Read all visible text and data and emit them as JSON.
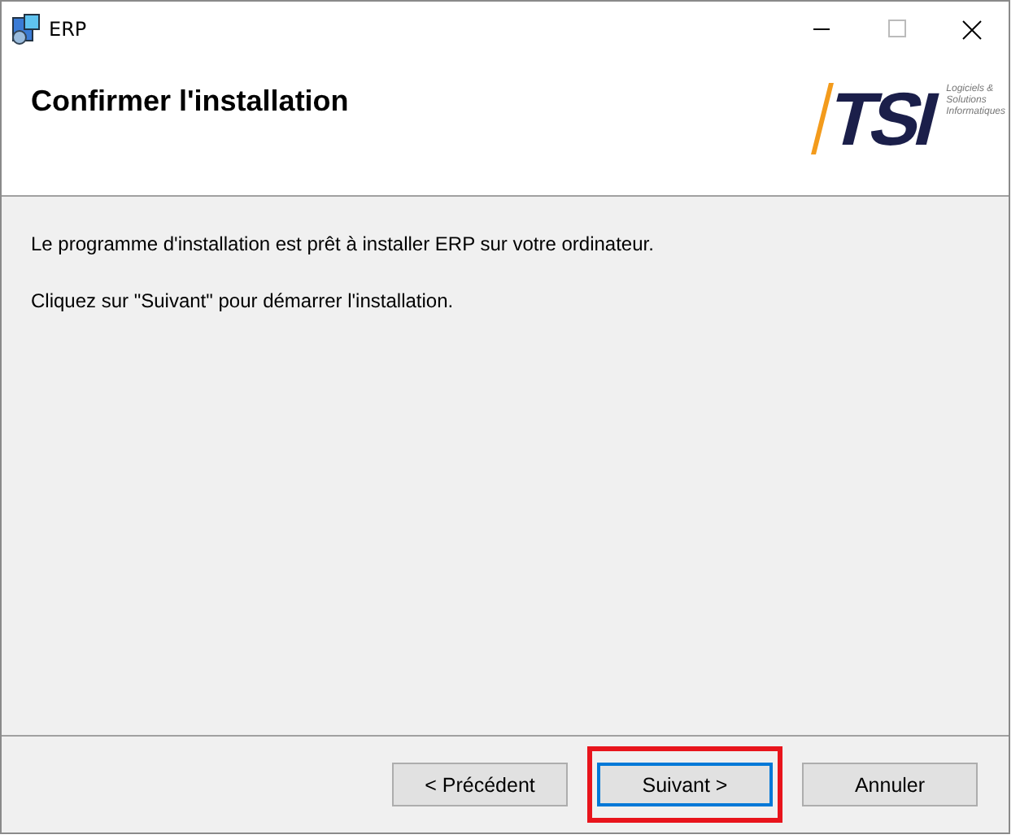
{
  "window": {
    "title": "ERP"
  },
  "header": {
    "title": "Confirmer l'installation",
    "logo": {
      "letters": "TSI",
      "tagline": [
        "Logiciels &",
        "Solutions",
        "Informatiques"
      ]
    }
  },
  "body": {
    "paragraphs": [
      "Le programme d'installation est prêt à installer ERP sur votre ordinateur.",
      "Cliquez sur \"Suivant\" pour démarrer l'installation."
    ]
  },
  "buttons": [
    {
      "label": "< Précédent",
      "focused": false,
      "highlighted": false
    },
    {
      "label": "Suivant >",
      "focused": true,
      "highlighted": true
    },
    {
      "label": "Annuler",
      "focused": false,
      "highlighted": false
    }
  ]
}
